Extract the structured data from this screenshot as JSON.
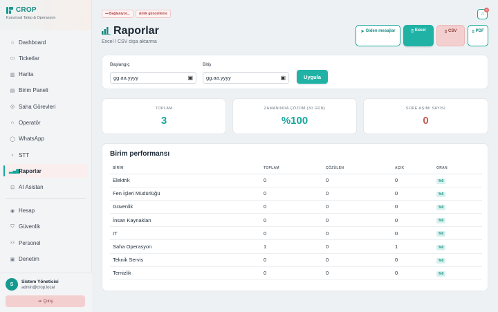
{
  "app": {
    "name": "CROP",
    "subtitle": "Kurumsal Talep & Operasyon"
  },
  "sidebar": {
    "items": [
      {
        "label": "Dashboard",
        "icon": "dashboard-icon",
        "glyph": "⌂"
      },
      {
        "label": "Ticketlar",
        "icon": "ticket-icon",
        "glyph": "▭"
      },
      {
        "label": "Harita",
        "icon": "map-icon",
        "glyph": "▥"
      },
      {
        "label": "Birim Paneli",
        "icon": "building-icon",
        "glyph": "▤"
      },
      {
        "label": "Saha Görevleri",
        "icon": "location-pin-icon",
        "glyph": "◎"
      },
      {
        "label": "Operatör",
        "icon": "headset-icon",
        "glyph": "∩"
      },
      {
        "label": "WhatsApp",
        "icon": "whatsapp-icon",
        "glyph": "◯"
      },
      {
        "label": "STT",
        "icon": "microphone-icon",
        "glyph": "♁"
      },
      {
        "label": "Raporlar",
        "icon": "bar-chart-icon",
        "glyph": "▂▄▆"
      },
      {
        "label": "AI Asistan",
        "icon": "ai-bot-icon",
        "glyph": "⊡"
      }
    ],
    "secondary": [
      {
        "label": "Hesap",
        "icon": "user-circle-icon",
        "glyph": "◉"
      },
      {
        "label": "Güvenlik",
        "icon": "shield-icon",
        "glyph": "⛉"
      },
      {
        "label": "Personel",
        "icon": "users-icon",
        "glyph": "⚇"
      },
      {
        "label": "Denetim",
        "icon": "clipboard-icon",
        "glyph": "▣"
      }
    ],
    "active": "Raporlar",
    "user": {
      "initial": "S",
      "name": "Sistem Yöneticisi",
      "email": "admin@crop.local"
    },
    "logout": "Çıkış"
  },
  "header": {
    "pills": [
      "Bağlanıyor...",
      "Anlık güncelleme"
    ],
    "notif_count": "0",
    "title": "Raporlar",
    "subtitle": "Excel / CSV dışa aktarma",
    "actions": {
      "outgoing": "Giden mesajlar",
      "excel": "Excel",
      "csv": "CSV",
      "pdf": "PDF"
    }
  },
  "filter": {
    "start_label": "Başlangıç",
    "start_value": "gg.aa.yyyy",
    "end_label": "Bitiş",
    "end_value": "gg.aa.yyyy",
    "apply": "Uygula"
  },
  "stats": [
    {
      "label": "TOPLAM",
      "value": "3",
      "color": "#17a79c"
    },
    {
      "label": "ZAMANINDA ÇÖZÜM (30 GÜN)",
      "value": "%100",
      "color": "#17a79c"
    },
    {
      "label": "SÜRE AŞIMI SAYISI",
      "value": "0",
      "color": "#c45a52"
    }
  ],
  "performance": {
    "title": "Birim performansı",
    "columns": [
      "BİRİM",
      "TOPLAM",
      "ÇÖZÜLEN",
      "AÇIK",
      "ORAN"
    ],
    "rows": [
      [
        "Elektrik",
        "0",
        "0",
        "0",
        "%0"
      ],
      [
        "Fen İşleri Müdürlüğü",
        "0",
        "0",
        "0",
        "%0"
      ],
      [
        "Güvenlik",
        "0",
        "0",
        "0",
        "%0"
      ],
      [
        "İnsan Kaynakları",
        "0",
        "0",
        "0",
        "%0"
      ],
      [
        "IT",
        "0",
        "0",
        "0",
        "%0"
      ],
      [
        "Saha Operasyon",
        "1",
        "0",
        "1",
        "%0"
      ],
      [
        "Teknik Servis",
        "0",
        "0",
        "0",
        "%0"
      ],
      [
        "Temizlik",
        "0",
        "0",
        "0",
        "%0"
      ]
    ]
  }
}
